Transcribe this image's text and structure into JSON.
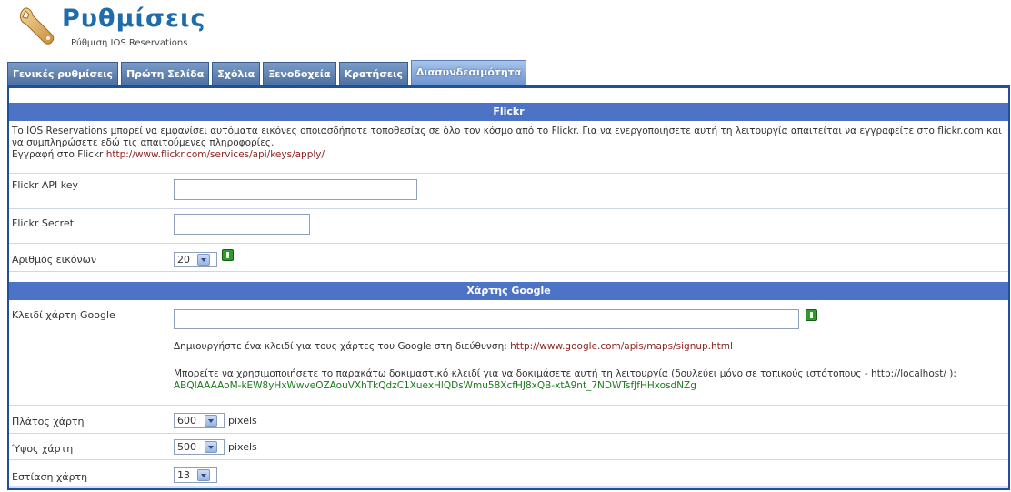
{
  "header": {
    "title": "Ρυθμίσεις",
    "subtitle": "Ρύθμιση IOS Reservations",
    "icon": "wrench-icon"
  },
  "tabs": [
    {
      "label": "Γενικές ρυθμίσεις",
      "active": false
    },
    {
      "label": "Πρώτη Σελίδα",
      "active": false
    },
    {
      "label": "Σχόλια",
      "active": false
    },
    {
      "label": "Ξενοδοχεία",
      "active": false
    },
    {
      "label": "Κρατήσεις",
      "active": false
    },
    {
      "label": "Διασυνδεσιμότητα",
      "active": true
    }
  ],
  "flickr": {
    "heading": "Flickr",
    "description": "Το IOS Reservations μπορεί να εμφανίσει αυτόματα εικόνες οποιασδήποτε τοποθεσίας σε όλο τον κόσμο από το Flickr. Για να ενεργοποιήσετε αυτή τη λειτουργία απαιτείται να εγγραφείτε στο flickr.com και να συμπληρώσετε εδώ τις απαιτούμενες πληροφορίες.",
    "register_label": "Εγγραφή στο Flickr",
    "register_url": "http://www.flickr.com/services/api/keys/apply/",
    "api_key_label": "Flickr API key",
    "api_key_value": "",
    "secret_label": "Flickr Secret",
    "secret_value": "",
    "images_label": "Αριθμός εικόνων",
    "images_value": "20"
  },
  "google": {
    "heading": "Χάρτης Google",
    "key_label": "Κλειδί χάρτη Google",
    "key_value": "",
    "create_key_text": "Δημιουργήστε ένα κλειδί για τους χάρτες του Google στη διεύθυνση:",
    "create_key_url": "http://www.google.com/apis/maps/signup.html",
    "test_key_text": "Μπορείτε να χρησιμοποιήσετε το παρακάτω δοκιμαστικό κλειδί για να δοκιμάσετε αυτή τη λειτουργία (δουλεύει μόνο σε τοπικούς ιστότοπους - http://localhost/ ):",
    "test_key_value": "ABQIAAAAoM-kEW8yHxWwveOZAouVXhTkQdzC1XuexHlQDsWmu58XcfHJ8xQB-xtA9nt_7NDWTsfJfHHxosdNZg",
    "width_label": "Πλάτος χάρτη",
    "width_value": "600",
    "height_label": "Ύψος χάρτη",
    "height_value": "500",
    "zoom_label": "Εστίαση χάρτη",
    "zoom_value": "13",
    "unit_label": "pixels"
  },
  "colors": {
    "title": "#1f6cad",
    "section_header": "#4d73c7",
    "panel_border": "#1f4f9e",
    "link": "#8b1f1f",
    "test_key": "#1a7a1a"
  }
}
